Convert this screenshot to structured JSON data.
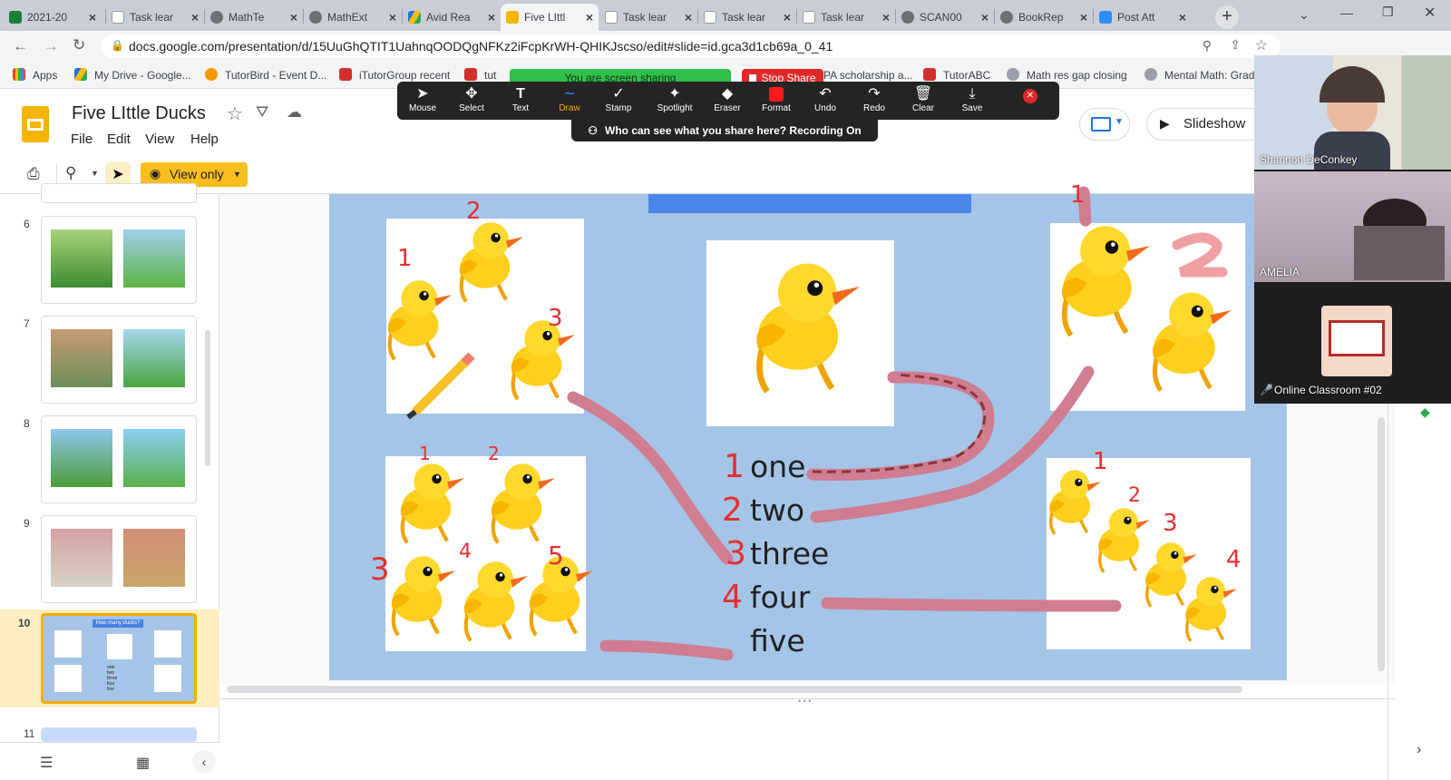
{
  "browser": {
    "tabs": [
      {
        "label": "2021-20",
        "color": "#188038",
        "active": false
      },
      {
        "label": "Task lear",
        "color": "#e8eaed",
        "active": false
      },
      {
        "label": "MathTe",
        "color": "#5f6368",
        "active": false
      },
      {
        "label": "MathExt",
        "color": "#5f6368",
        "active": false
      },
      {
        "label": "Avid Rea",
        "color": "#fbbc04",
        "active": false
      },
      {
        "label": "Five LIttl",
        "color": "#f4b400",
        "active": true
      },
      {
        "label": "Task lear",
        "color": "#e8eaed",
        "active": false
      },
      {
        "label": "Task lear",
        "color": "#e8eaed",
        "active": false
      },
      {
        "label": "Task lear",
        "color": "#e8eaed",
        "active": false
      },
      {
        "label": "SCAN00",
        "color": "#5f6368",
        "active": false
      },
      {
        "label": "BookRep",
        "color": "#5f6368",
        "active": false
      },
      {
        "label": "Post Att",
        "color": "#2d8cff",
        "active": false
      }
    ],
    "new_tab": "+",
    "url": "docs.google.com/presentation/d/15UuGhQTIT1UahnqOODQgNFKz2iFcpKrWH-QHIKJscso/edit#slide=id.gca3d1cb69a_0_41",
    "bookmarks": [
      {
        "label": "Apps"
      },
      {
        "label": "My Drive - Google..."
      },
      {
        "label": "TutorBird - Event D..."
      },
      {
        "label": "iTutorGroup recent"
      },
      {
        "label": "tut"
      },
      {
        "label": "PA scholarship a..."
      },
      {
        "label": "TutorABC"
      },
      {
        "label": "Math res gap closing"
      },
      {
        "label": "Mental Math: Grad"
      }
    ]
  },
  "zoom": {
    "screen_sharing": "You are screen sharing",
    "stop_share": "Stop Share",
    "tools": [
      "Mouse",
      "Select",
      "Text",
      "Draw",
      "Stamp",
      "Spotlight",
      "Eraser",
      "Format",
      "Undo",
      "Redo",
      "Clear",
      "Save"
    ],
    "active_tool": "Draw",
    "banner": "Who can see what you share here? Recording On",
    "participants": [
      {
        "name": "Shannon DeConkey"
      },
      {
        "name": "AMELIA"
      },
      {
        "name": "Online Classroom #02"
      }
    ]
  },
  "docs": {
    "title": "Five LIttle Ducks",
    "menu": [
      "File",
      "Edit",
      "View",
      "Help"
    ],
    "slideshow": "Slideshow",
    "view_only": "View only"
  },
  "slides_panel": {
    "numbers": [
      "6",
      "7",
      "8",
      "9",
      "10",
      "11"
    ],
    "selected": "10",
    "thumb10_title": "How many ducks?",
    "thumb10_words": [
      "one",
      "two",
      "three",
      "four",
      "five"
    ]
  },
  "slide": {
    "words": [
      "one",
      "two",
      "three",
      "four",
      "five"
    ],
    "card_numbers": {
      "card1": [
        "1",
        "2",
        "3"
      ],
      "card3": [
        "1",
        "2"
      ],
      "card4": [
        "1",
        "2",
        "3",
        "4",
        "5"
      ],
      "card6": [
        "1",
        "2",
        "3",
        "4"
      ]
    },
    "word_numbers": [
      "1",
      "2",
      "3",
      "4"
    ]
  }
}
